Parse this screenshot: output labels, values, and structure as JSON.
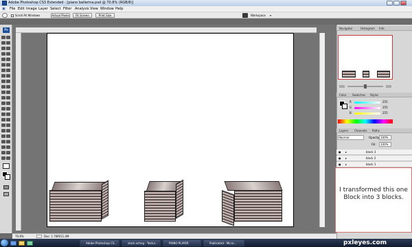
{
  "app": {
    "window_title": "Adobe Photoshop CS3 Extended - [piano ballerina.psd @ 70.8% (RGB/8)]"
  },
  "menubar": {
    "items": [
      "File",
      "Edit",
      "Image",
      "Layer",
      "Select",
      "Filter",
      "Analysis",
      "View",
      "Window",
      "Help"
    ]
  },
  "options_bar": {
    "scroll_all_label": "Scroll All Windows",
    "actual_pixels_label": "Actual Pixels",
    "fit_screen_label": "Fit Screen",
    "print_size_label": "Print Size",
    "workspace_label": "Workspace"
  },
  "panels": {
    "top_tabs": [
      "Navigator",
      "Histogram",
      "Info"
    ],
    "color_tabs": [
      "Color",
      "Swatches",
      "Styles"
    ],
    "layers_tabs": [
      "Layers",
      "Channels",
      "Paths"
    ],
    "layers_blend_mode": "Normal",
    "layers_opacity_label": "Opacity:",
    "layers_opacity_value": "100%",
    "layers_fill_label": "Fill:",
    "layers_fill_value": "100%",
    "color_values": {
      "r": "255",
      "g": "255",
      "b": "255"
    },
    "layers": [
      "block 3",
      "block 2",
      "block 1"
    ]
  },
  "status": {
    "zoom": "70.8%",
    "doc_info": "Doc: 1.76M/11.4M"
  },
  "note": {
    "text": "I transformed this one Block into 3 blocks."
  },
  "taskbar": {
    "items": [
      "Adobe Photoshop CS...",
      "stock.xchng - Textur...",
      "PIANO PLAYER",
      "Publicated - Micro..."
    ]
  },
  "watermark": "pxleyes.com",
  "colors": {
    "accent": "#1c4f9a",
    "canvas": "#ffffff",
    "workspace": "#747474"
  }
}
